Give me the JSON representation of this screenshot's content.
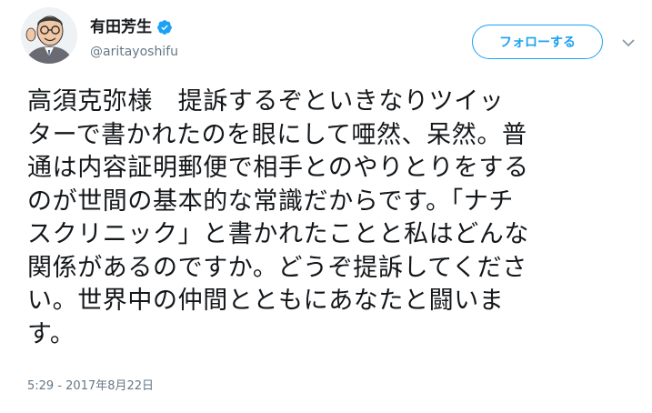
{
  "user": {
    "display_name": "有田芳生",
    "handle": "@aritayoshifu",
    "verified": true
  },
  "follow_button": {
    "label": "フォローする"
  },
  "tweet": {
    "lines": [
      "高須克弥様　提訴するぞといきなりツイッ",
      "ターで書かれたのを眼にして唖然、呆然。普",
      "通は内容証明郵便で相手とのやりとりをする",
      "のが世間の基本的な常識だからです。「ナチ",
      "スクリニック」と書かれたことと私はどんな",
      "関係があるのですか。どうぞ提訴してくださ",
      "い。世界中の仲間とともにあなたと闘いま",
      "す。"
    ],
    "timestamp": "5:29 - 2017年8月22日"
  },
  "icons": {
    "avatar": "avatar-caricature",
    "verified": "verified-badge-icon",
    "more": "chevron-down-icon"
  },
  "colors": {
    "accent": "#1da1f2",
    "text": "#14171a",
    "secondary": "#657786"
  }
}
